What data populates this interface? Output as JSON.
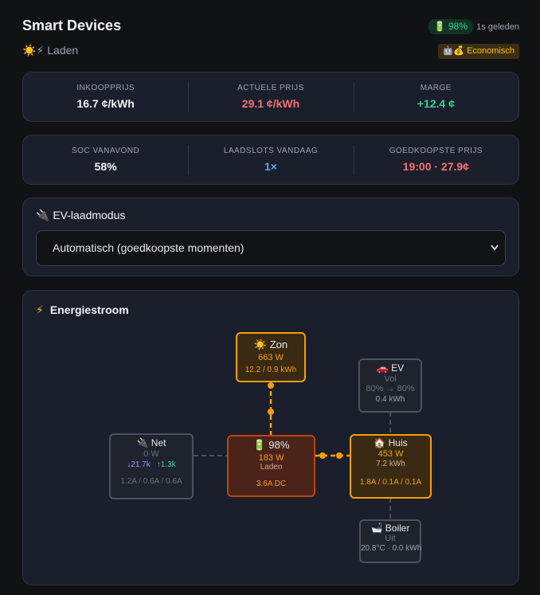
{
  "header": {
    "title": "Smart Devices",
    "mode_emoji": "☀️⚡",
    "mode_label": "Laden",
    "battery_badge": "🔋 98%",
    "updated": "1s geleden",
    "strategy_badge": "🤖💰 Economisch"
  },
  "prices": [
    {
      "label": "INKOOPPRIJS",
      "value": "16.7 ¢/kWh",
      "color": "#f3f4f6"
    },
    {
      "label": "ACTUELE PRIJS",
      "value": "29.1 ¢/kWh",
      "color": "#f87171"
    },
    {
      "label": "MARGE",
      "value": "+12.4 ¢",
      "color": "#34d399"
    }
  ],
  "planning": [
    {
      "label": "SOC VANAVOND",
      "value": "58%",
      "color": "#f3f4f6"
    },
    {
      "label": "LAADSLOTS VANDAAG",
      "value": "1×",
      "color": "#60a5fa"
    },
    {
      "label": "GOEDKOOPSTE PRIJS",
      "value": "19:00 · 27.9¢",
      "color": "#f87171"
    }
  ],
  "ev_mode": {
    "title": "🔌 EV-laadmodus",
    "selected": "Automatisch (goedkoopste momenten)"
  },
  "energy_flow": {
    "title": "Energiestroom",
    "solar": {
      "name": "☀️ Zon",
      "power": "663 W",
      "energy": "12.2 / 0.9 kWh"
    },
    "ev": {
      "name": "🚗 EV",
      "status": "Vol",
      "soc": "80% → 80%",
      "energy": "0.4 kWh"
    },
    "grid": {
      "name": "🔌 Net",
      "power": "0 W",
      "import": "↓21.7k",
      "export": "↑1.3k",
      "currents": "1.2A / 0.6A / 0.6A"
    },
    "battery": {
      "name": "🔋 98%",
      "power": "183 W",
      "status": "Laden",
      "current": "3.6A DC"
    },
    "house": {
      "name": "🏠 Huis",
      "power": "453 W",
      "energy": "7.2 kWh",
      "currents": "1.8A / 0.1A / 0.1A"
    },
    "boiler": {
      "name": "🛁 Boiler",
      "status": "Uit",
      "detail": "20.8°C · 0.0 kWh"
    }
  },
  "colors": {
    "accent_orange": "#f59e0b",
    "battery_red": "#c2410c",
    "import_purple": "#a78bfa",
    "export_green": "#34d399"
  }
}
